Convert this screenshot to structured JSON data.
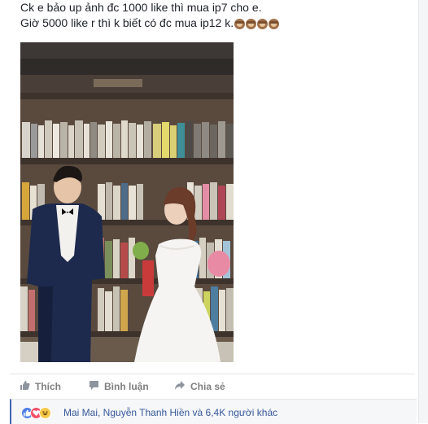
{
  "post": {
    "line1": "Ck e bảo up ảnh đc 1000 like thì mua ip7 cho e.",
    "line2": "Giờ 5000 like r thì k biết có đc mua ip12 k.",
    "emoji": [
      "see-no-evil-monkey",
      "see-no-evil-monkey",
      "see-no-evil-monkey",
      "see-no-evil-monkey"
    ]
  },
  "actions": {
    "like": "Thích",
    "comment": "Bình luận",
    "share": "Chia sẻ"
  },
  "reactions": {
    "icons": [
      "like",
      "love",
      "haha"
    ],
    "text": "Mai Mai, Nguyễn Thanh Hiền và 6,4K người khác"
  },
  "colors": {
    "link": "#365899",
    "action_text": "#7f7f7f",
    "like_blue": "#4c7de6",
    "love_red": "#f25268",
    "haha_yellow": "#f7c84a"
  }
}
